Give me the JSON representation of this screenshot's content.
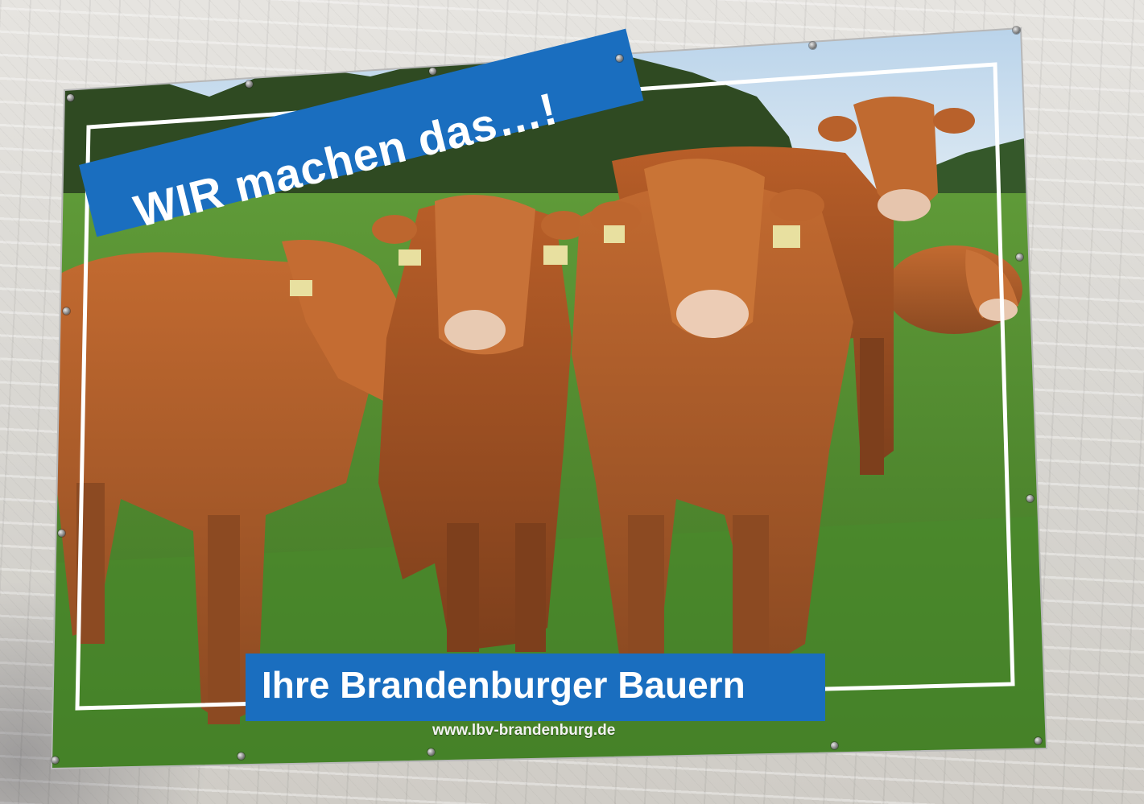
{
  "banner": {
    "headline": "WIR machen das…!",
    "subtitle": "Ihre Brandenburger Bauern",
    "website": "www.lbv-brandenburg.de"
  },
  "colors": {
    "strip_blue": "#1a6ebf",
    "cow_brown": "#b5622c",
    "grass_green": "#4f8a2e",
    "wall_gray": "#d9d7d2"
  }
}
